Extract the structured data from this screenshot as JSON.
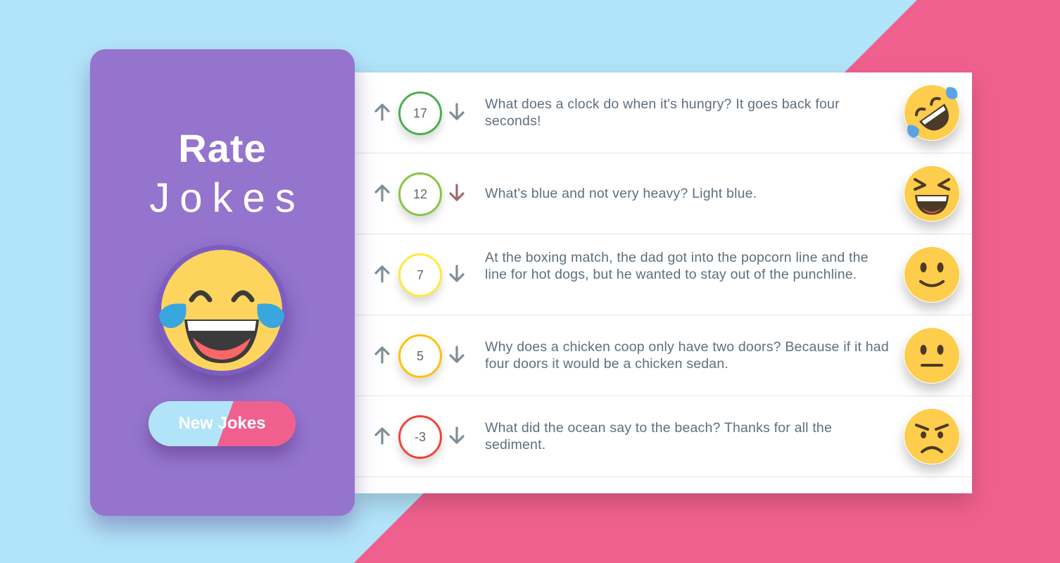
{
  "app": {
    "title_line1": "Rate",
    "title_line2": "Jokes",
    "hero_icon": "laughing-tears-emoji",
    "new_jokes_label": "New Jokes"
  },
  "colors": {
    "background_left": "#b2e4f9",
    "background_right": "#f0608e",
    "sidebar": "#9474cd",
    "emoji_yellow": "#fdcd4b",
    "text": "#5f6f7d",
    "arrow": "#7e8d97",
    "arrow_down_voted": "#a06a6a"
  },
  "jokes": [
    {
      "text": "What does a clock do when it's hungry? It goes back four seconds!",
      "score": "17",
      "score_color": "#4caf50",
      "emoji": "rolling-on-floor-laughing-emoji"
    },
    {
      "text": "What's blue and not very heavy? Light blue.",
      "score": "12",
      "score_color": "#8bc34a",
      "emoji": "grinning-squinting-emoji"
    },
    {
      "text": "At the boxing match, the dad got into the popcorn line and the line for hot dogs, but he wanted to stay out of the punchline.",
      "score": "7",
      "score_color": "#ffeb3b",
      "emoji": "slightly-smiling-emoji"
    },
    {
      "text": "Why does a chicken coop only have two doors? Because if it had four doors it would be a chicken sedan.",
      "score": "5",
      "score_color": "#ffc107",
      "emoji": "neutral-face-emoji"
    },
    {
      "text": "What did the ocean say to the beach? Thanks for all the sediment.",
      "score": "-3",
      "score_color": "#f44336",
      "emoji": "angry-face-emoji"
    }
  ]
}
